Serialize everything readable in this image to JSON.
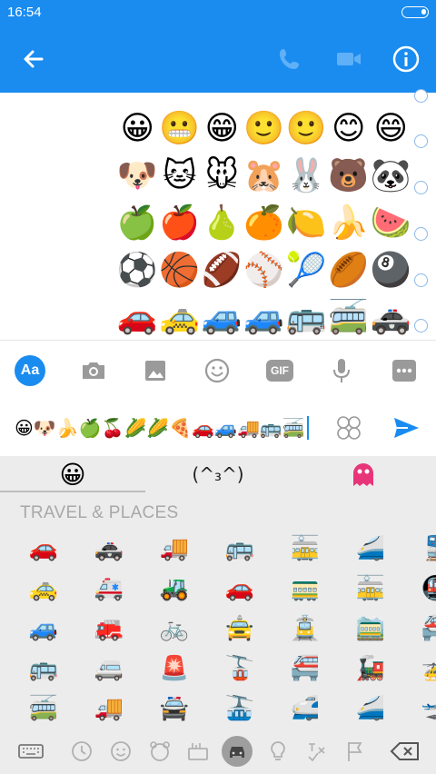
{
  "status_bar": {
    "time": "16:54"
  },
  "colors": {
    "accent": "#1a8cf0",
    "keyboard_bg": "#ececec",
    "muted": "#9e9e9e"
  },
  "app_bar": {
    "icons": [
      "back-arrow-icon",
      "phone-icon",
      "video-camera-icon",
      "info-icon"
    ]
  },
  "chat": {
    "emoji_rows": [
      [
        "😀",
        "😬",
        "😁",
        "🙂",
        "🙂",
        "😊",
        "😄"
      ],
      [
        "🐶",
        "🐱",
        "🐭",
        "🐹",
        "🐰",
        "🐻",
        "🐼"
      ],
      [
        "🍏",
        "🍎",
        "🍐",
        "🍊",
        "🍋",
        "🍌",
        "🍉"
      ],
      [
        "⚽",
        "🏀",
        "🏈",
        "⚾",
        "🎾",
        "🏉",
        "🎱"
      ],
      [
        "🚗",
        "🚕",
        "🚙",
        "🚙",
        "🚌",
        "🚎",
        "🚓"
      ]
    ]
  },
  "composer": {
    "aa_label": "Aa",
    "gif_label": "GIF",
    "tool_icons": [
      "camera-icon",
      "image-icon",
      "emoji-icon",
      "gif-icon",
      "microphone-icon",
      "more-icon"
    ],
    "message_value": "😀🐶🍌🍏🍒🌽🌽🍕🚗🚙🚚🚌🚎"
  },
  "keyboard": {
    "tabs": {
      "emoji_glyph": "😀",
      "kaomoji_text": "(^₃^)",
      "sticker_icon": "ghost-icon"
    },
    "category_title": "TRAVEL & PLACES",
    "rows": [
      [
        "🚗",
        "🚓",
        "🚚",
        "🚌",
        "🚋",
        "🚄",
        "🚆"
      ],
      [
        "🚕",
        "🚑",
        "🚜",
        "🚗",
        "🚃",
        "🚋",
        "🚇"
      ],
      [
        "🚙",
        "🚒",
        "🚲",
        "🚖",
        "🚊",
        "🚞",
        "🚝"
      ],
      [
        "🚌",
        "🚐",
        "🚨",
        "🚡",
        "🚝",
        "🚂",
        "🚁"
      ],
      [
        "🚎",
        "🚚",
        "🚔",
        "🚠",
        "🚅",
        "🚄",
        "🛫"
      ]
    ],
    "bottom_icons": [
      "keyboard-icon",
      "clock-icon",
      "smiley-icon",
      "animal-icon",
      "food-icon",
      "car-icon",
      "bulb-icon",
      "symbols-icon",
      "flag-icon",
      "backspace-icon"
    ]
  }
}
